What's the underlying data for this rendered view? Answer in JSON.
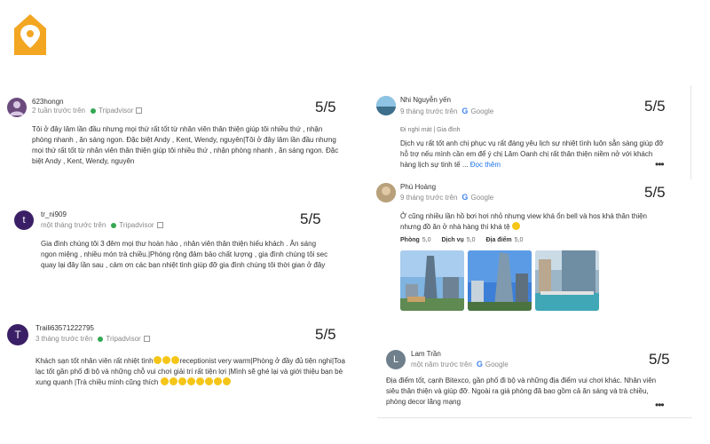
{
  "brand": {
    "logo_icon": "location-pin-house-icon",
    "color": "#f2a622"
  },
  "reviews": {
    "r1": {
      "author": "623hongn",
      "time": "2 tuần trước trên",
      "source": "Tripadvisor",
      "score": "5/5",
      "text": "Tôi ở đây lâm lần đầu nhưng mọi thứ rất tốt từ nhân viên thân thiện giúp tôi nhiều thứ , nhận phòng nhanh , ăn sáng ngon. Đặc biệt Andy , Kent, Wendy, nguyên|Tôi ở đây lâm lần đầu nhưng mọi thứ rất tốt từ nhân viên thân thiện giúp tôi nhiều thứ , nhận phòng nhanh , ăn sáng ngon. Đặc biệt Andy , Kent, Wendy, nguyên"
    },
    "r2": {
      "author": "tr_ni909",
      "avatar_letter": "t",
      "time": "một tháng trước trên",
      "source": "Tripadvisor",
      "score": "5/5",
      "text": "Gia đình chúng tôi 3 đêm mọi thư hoàn hảo , nhân viên thân thiện hiếu khách . Ăn sáng ngon miệng , nhiều món trà chiều.|Phòng rộng đảm bảo chất lượng , gia đình chúng tôi sec quay lại đây lần sau , cảm ơn các bạn nhiệt tình giúp đỡ gia đình chúng tôi thời gian ở đây"
    },
    "r3": {
      "author": "Traili63571222795",
      "avatar_letter": "T",
      "time": "3 tháng trước trên",
      "source": "Tripadvisor",
      "score": "5/5",
      "text_a": "Khách sạn tốt nhân viên rất nhiệt tình",
      "text_b": "receptionist very warm|Phòng ở đầy đủ tiện nghi|Toạ lạc tốt gần phố đi bộ và những chỗ vui chơi giải trí rất tiện lợi |Mình sẽ ghé lại và giới thiệu bạn bè xung quanh |Trà chiều mình cũng thích"
    },
    "r4": {
      "author": "Nhi Nguyễn yến",
      "time": "9 tháng trước trên",
      "source": "Google",
      "score": "5/5",
      "trip": "Đi nghỉ mát | Gia đình",
      "text": "Dịch vụ rất tốt anh chị phục vụ rất đáng yêu lịch sự nhiệt tình luôn sẵn sàng giúp đỡ hỗ trợ nếu mình cần em để ý chị Lâm Oanh chị rất thân thiện niềm nở với khách hàng lịch sự tinh tế ...",
      "more": "Đọc thêm"
    },
    "r5": {
      "author": "Phú Hoàng",
      "time": "9 tháng trước trên",
      "source": "Google",
      "score": "5/5",
      "text": "Ở cũng nhiều lần hồ bơi hơi nhỏ nhưng view khá ổn bell và hos khá thân thiện nhưng đồ ăn ở nhà hàng thì khá tệ",
      "ratings": [
        {
          "label": "Phòng",
          "value": "5,0"
        },
        {
          "label": "Dịch vụ",
          "value": "5,0"
        },
        {
          "label": "Địa điểm",
          "value": "5,0"
        }
      ]
    },
    "r6": {
      "author": "Lam Trần",
      "avatar_letter": "L",
      "time": "một năm trước trên",
      "source": "Google",
      "score": "5/5",
      "text": "Địa điểm tốt, cạnh Bitexco, gần phố đi bộ và những địa điểm vui chơi khác. Nhân viên siêu thân thiện và giúp đỡ. Ngoài ra giá phòng đã bao gồm cả ăn sáng và trà chiều, phòng decor lãng mạng"
    }
  }
}
